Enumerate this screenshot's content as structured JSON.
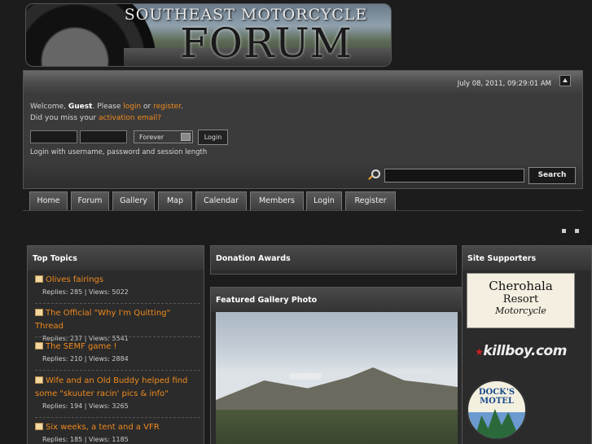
{
  "banner": {
    "line1": "SOUTHEAST MOTORCYCLE",
    "line2": "FORUM"
  },
  "userpanel": {
    "date": "July 08, 2011, 09:29:01 AM",
    "welcome_prefix": "Welcome, ",
    "guest": "Guest",
    "please": ". Please ",
    "login_link": "login",
    "or": " or ",
    "register_link": "register",
    "dot": ".",
    "missed_prefix": "Did you miss your ",
    "activation_link": "activation email?",
    "session_select": "Forever",
    "login_button": "Login",
    "login_hint": "Login with username, password and session length",
    "search_button": "Search"
  },
  "nav": {
    "tabs": [
      "Home",
      "Forum",
      "Gallery",
      "Map",
      "Calendar",
      "Members",
      "Login",
      "Register"
    ]
  },
  "top_topics": {
    "title": "Top Topics",
    "items": [
      {
        "title": "Olives fairings",
        "meta": "Replies: 285 | Views: 5022"
      },
      {
        "title": "The Official \"Why I'm Quitting\" Thread",
        "meta": "Replies: 237 | Views: 5541"
      },
      {
        "title": "The SEMF game !",
        "meta": "Replies: 210 | Views: 2884"
      },
      {
        "title": "Wife and an Old Buddy helped find some \"skuuter racin' pics & info\"",
        "meta": "Replies: 194 | Views: 3265"
      },
      {
        "title": "Six weeks, a tent and a VFR",
        "meta": "Replies: 185 | Views: 1185"
      }
    ]
  },
  "donation": {
    "title": "Donation Awards"
  },
  "featured": {
    "title": "Featured Gallery Photo"
  },
  "supporters": {
    "title": "Site Supporters",
    "cherohala": [
      "Cherohala",
      "Resort",
      "Motorcycle"
    ],
    "killboy": "killboy.com",
    "dock": "DOCK'S MOTEL"
  },
  "colors": {
    "link": "#f08a1e",
    "background": "#1c1c1c",
    "panel": "#2b2b2b"
  }
}
